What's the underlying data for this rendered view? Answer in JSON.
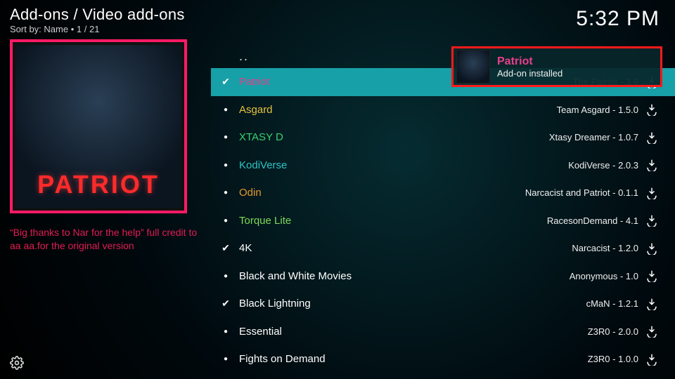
{
  "header": {
    "breadcrumb": "Add-ons / Video add-ons",
    "sort_label": "Sort by:",
    "sort_value": "Name",
    "position": "1 / 21"
  },
  "clock": "5:32 PM",
  "sidebar": {
    "poster_title": "PATRIOT",
    "description": "“Big thanks to Nar for the help” full credit to aa aa.for the original version"
  },
  "list": {
    "dots": "..",
    "items": [
      {
        "name": "Patriot",
        "color": "c-pink",
        "installed": true,
        "selected": true,
        "meta": "The Patriot - 3.9"
      },
      {
        "name": "Asgard",
        "color": "c-yellow",
        "installed": false,
        "meta": "Team Asgard - 1.5.0"
      },
      {
        "name": "XTASY D",
        "color": "c-green",
        "installed": false,
        "meta": "Xtasy Dreamer - 1.0.7"
      },
      {
        "name": "KodiVerse",
        "color": "c-teal",
        "installed": false,
        "meta": "KodiVerse - 2.0.3"
      },
      {
        "name": "Odin",
        "color": "c-orange",
        "installed": false,
        "meta": "Narcacist and Patriot - 0.1.1"
      },
      {
        "name": "Torque Lite",
        "color": "c-lime",
        "installed": false,
        "meta": "RacesonDemand - 4.1"
      },
      {
        "name": "4K",
        "color": "c-white",
        "installed": true,
        "meta": "Narcacist - 1.2.0"
      },
      {
        "name": "Black and White Movies",
        "color": "c-white",
        "installed": false,
        "meta": "Anonymous - 1.0"
      },
      {
        "name": "Black Lightning",
        "color": "c-white",
        "installed": true,
        "meta": "cMaN - 1.2.1"
      },
      {
        "name": "Essential",
        "color": "c-white",
        "installed": false,
        "meta": "Z3R0 - 2.0.0"
      },
      {
        "name": "Fights on Demand",
        "color": "c-white",
        "installed": false,
        "meta": "Z3R0 - 1.0.0"
      }
    ]
  },
  "notification": {
    "title": "Patriot",
    "subtitle": "Add-on installed"
  }
}
